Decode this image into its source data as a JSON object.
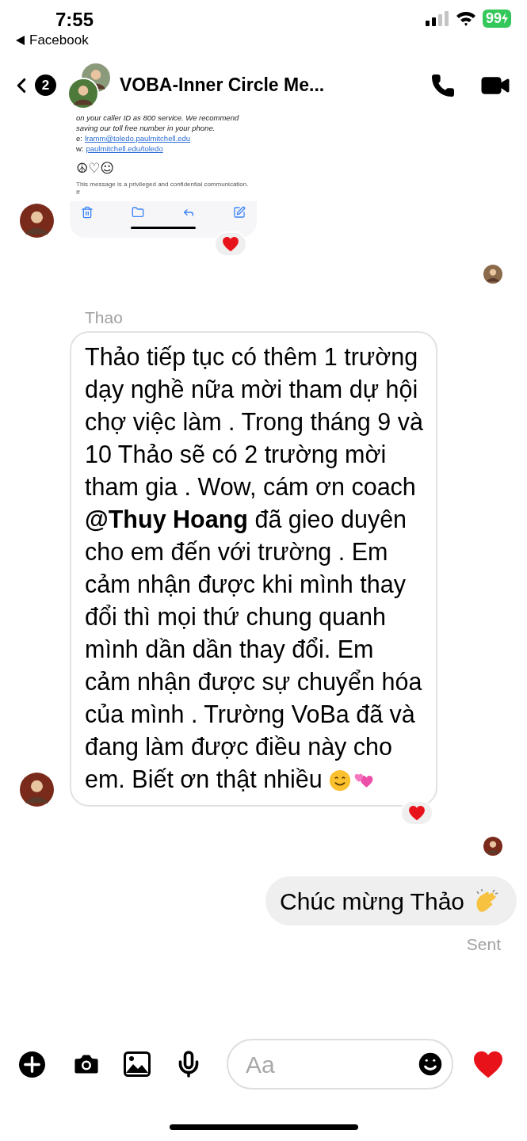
{
  "status_bar": {
    "time": "7:55",
    "back_app": "Facebook",
    "battery": "99"
  },
  "header": {
    "badge": "2",
    "title": "VOBA-Inner Circle Me..."
  },
  "messages": [
    {
      "kind": "screenshot",
      "lines": [
        "on your caller ID as 800 service. We recommend",
        "saving our toll free number in your phone."
      ],
      "links": [
        {
          "prefix": "e:",
          "text": "lramm@toledo.paulmitchell.edu"
        },
        {
          "prefix": "w:",
          "text": "paulmitchell.edu/toledo"
        }
      ],
      "symbols": "☮♡☺",
      "footer": "This message is a privileged and confidential communication. If",
      "reaction": true
    },
    {
      "kind": "text",
      "sender": "Thao",
      "text": "Thảo tiếp tục có thêm 1 trường dạy nghề nữa mời tham dự hội chợ việc làm . Trong tháng 9 và 10 Thảo sẽ có 2 trường mời tham gia . Wow, cám ơn coach **@Thuy Hoang**  đã gieo duyên cho em đến với trường . Em cảm nhận được khi mình thay đổi thì mọi thứ chung quanh mình dần dần thay đổi. Em cảm nhận được sự chuyển hóa của mình . Trường VoBa đã và đang làm được điều này cho em. Biết ơn thật nhiều",
      "reaction": true
    },
    {
      "kind": "outgoing",
      "text": "Chúc mừng Thảo",
      "status": "Sent"
    }
  ],
  "composer": {
    "placeholder": "Aa"
  }
}
